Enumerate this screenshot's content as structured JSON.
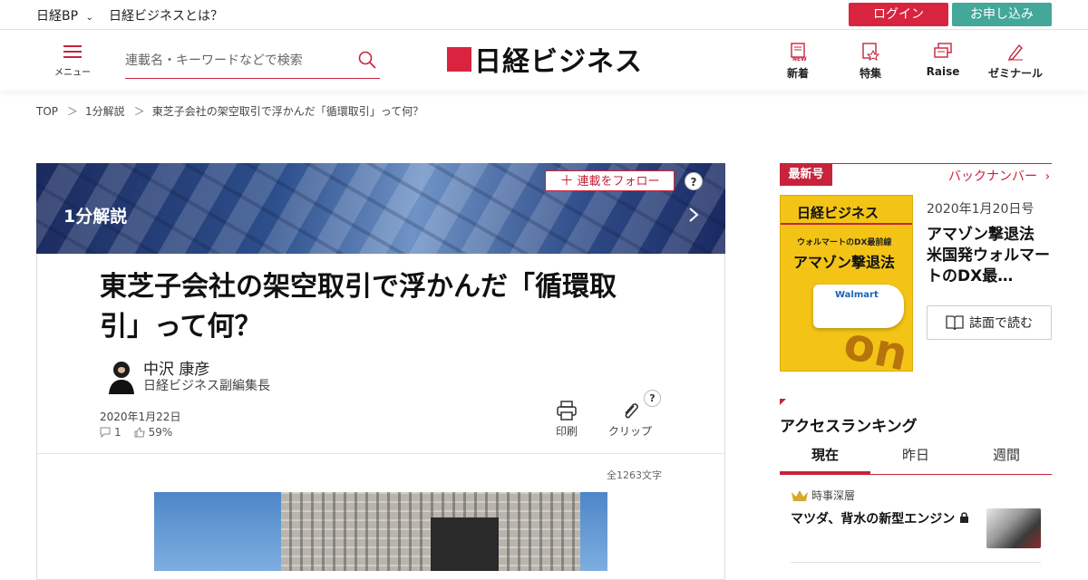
{
  "topbar": {
    "site_menu": "日経BP",
    "about": "日経ビジネスとは？",
    "login": "ログイン",
    "apply": "お申し込み"
  },
  "header": {
    "menu_label": "メニュー",
    "search_placeholder": "連載名・キーワードなどで検索",
    "logo_text": "日経ビジネス",
    "nav": [
      {
        "label": "新着",
        "icon": "new-icon"
      },
      {
        "label": "特集",
        "icon": "feature-icon"
      },
      {
        "label": "Raise",
        "icon": "raise-icon"
      },
      {
        "label": "ゼミナール",
        "icon": "seminar-icon"
      }
    ]
  },
  "breadcrumb": [
    "TOP",
    "1分解説",
    "東芝子会社の架空取引で浮かんだ「循環取引」って何？"
  ],
  "breadcrumb_sep": "＞",
  "article": {
    "series_title": "1分解説",
    "follow_label": "連載をフォロー",
    "help": "?",
    "title_line1": "東芝子会社の架空取引で浮かんだ「循環取",
    "title_line2": "引」って何？",
    "author_name": "中沢 康彦",
    "author_role": "日経ビジネス副編集長",
    "date": "2020年1月22日",
    "comments": "1",
    "likes": "59%",
    "print_label": "印刷",
    "clip_label": "クリップ",
    "char_count": "全1263文字"
  },
  "sidebar": {
    "latest_tag": "最新号",
    "backnumber": "バックナンバー",
    "cover": {
      "logo": "日経ビジネス",
      "kicker": "ウォルマートのDX最前線",
      "headline": "アマゾン撃退法",
      "brand": "Walmart",
      "big": "on"
    },
    "issue_date": "2020年1月20日号",
    "issue_title": "アマゾン撃退法 米国発ウォルマートのDX最…",
    "read_label": "誌面で読む",
    "ranking_title": "アクセスランキング",
    "tabs": [
      "現在",
      "昨日",
      "週間"
    ],
    "rank1_category": "時事深層",
    "rank1_title": "マツダ、背水の新型エンジン"
  },
  "colors": {
    "brand_red": "#d8243e",
    "apply_green": "#43a79a"
  }
}
